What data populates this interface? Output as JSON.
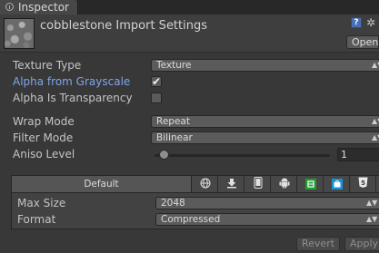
{
  "window": {
    "tab_label": "Inspector"
  },
  "header": {
    "title": "cobblestone Import Settings",
    "open_label": "Open"
  },
  "fields": {
    "texture_type": {
      "label": "Texture Type",
      "value": "Texture"
    },
    "alpha_from_grayscale": {
      "label": "Alpha from Grayscale",
      "checked": true,
      "check_glyph": "✔"
    },
    "alpha_is_transparency": {
      "label": "Alpha Is Transparency",
      "checked": false
    },
    "wrap_mode": {
      "label": "Wrap Mode",
      "value": "Repeat"
    },
    "filter_mode": {
      "label": "Filter Mode",
      "value": "Bilinear"
    },
    "aniso_level": {
      "label": "Aniso Level",
      "value": "1",
      "slider_fraction": 0.0
    }
  },
  "platforms": {
    "default_tab": "Default",
    "icons": [
      "globe-icon",
      "download-icon",
      "mobile-icon",
      "android-icon",
      "xbox-icon",
      "windows-store-icon",
      "html5-icon"
    ],
    "colors": {
      "xbox": "#1f9e2e",
      "windows_store": "#1e90d8",
      "html5": "#e9e9e9"
    }
  },
  "platform_settings": {
    "max_size": {
      "label": "Max Size",
      "value": "2048"
    },
    "format": {
      "label": "Format",
      "value": "Compressed"
    }
  },
  "footer": {
    "revert_label": "Revert",
    "apply_label": "Apply"
  },
  "glyphs": {
    "dropdown_arrow": "▲▼",
    "help": "?",
    "gear": "✲"
  },
  "colors": {
    "accent_label": "#7fa6ea",
    "panel_bg": "#383838"
  }
}
